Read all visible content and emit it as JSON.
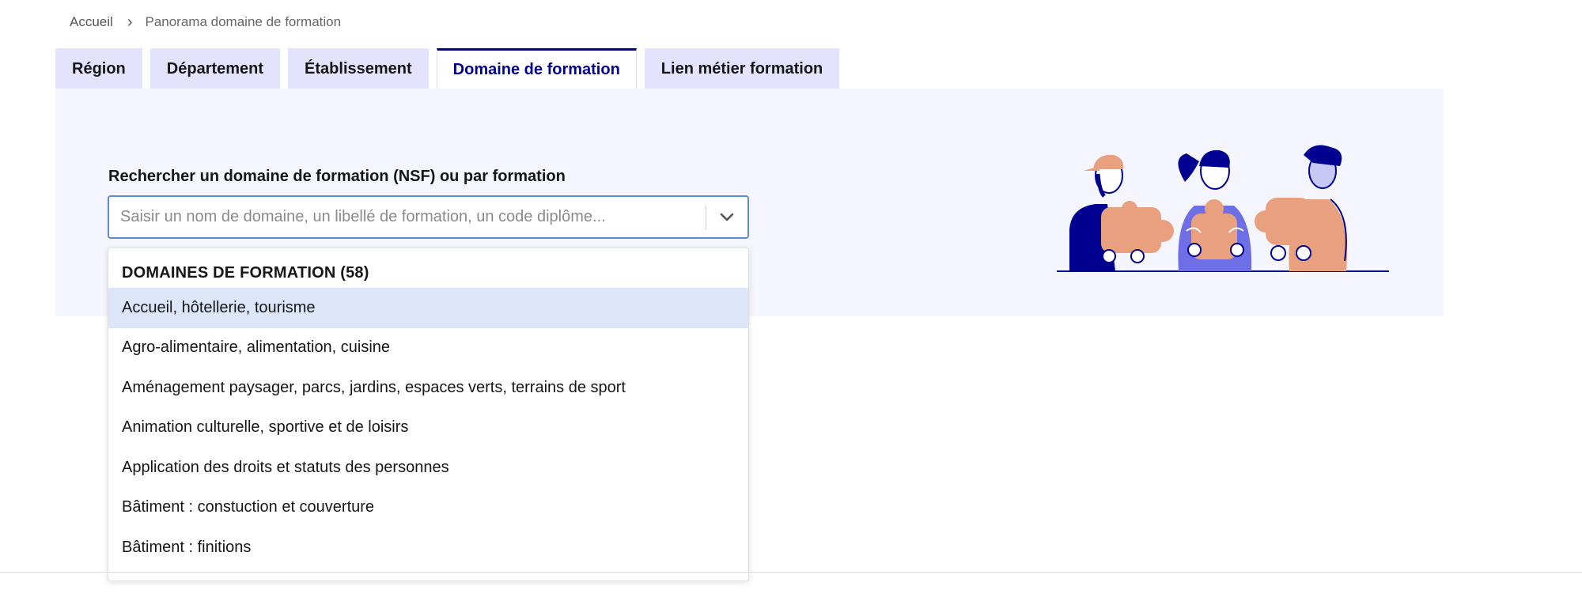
{
  "breadcrumb": {
    "home": "Accueil",
    "current": "Panorama domaine de formation"
  },
  "tabs": [
    {
      "label": "Région",
      "active": false
    },
    {
      "label": "Département",
      "active": false
    },
    {
      "label": "Établissement",
      "active": false
    },
    {
      "label": "Domaine de formation",
      "active": true
    },
    {
      "label": "Lien métier formation",
      "active": false
    }
  ],
  "search": {
    "label": "Rechercher un domaine de formation (NSF) ou par formation",
    "placeholder": "Saisir un nom de domaine, un libellé de formation, un code diplôme...",
    "value": ""
  },
  "dropdown": {
    "group_header": "DOMAINES DE FORMATION (58)",
    "options": [
      "Accueil, hôtellerie, tourisme",
      "Agro-alimentaire, alimentation, cuisine",
      "Aménagement paysager, parcs, jardins, espaces verts, terrains de sport",
      "Animation culturelle, sportive et de loisirs",
      "Application des droits et statuts des personnes",
      "Bâtiment : constuction et couverture",
      "Bâtiment : finitions"
    ],
    "highlighted_index": 0
  },
  "colors": {
    "accent": "#000091",
    "tab_bg": "#e3e3fd",
    "panel_bg": "#f5f5fe",
    "highlight": "#dce6f8",
    "illustration_orange": "#e8a07e",
    "illustration_purple": "#6e6ee6"
  },
  "icons": {
    "breadcrumb_separator": "chevron-right-icon",
    "combo_toggle": "chevron-down-icon",
    "illustration": "people-puzzle-illustration"
  }
}
